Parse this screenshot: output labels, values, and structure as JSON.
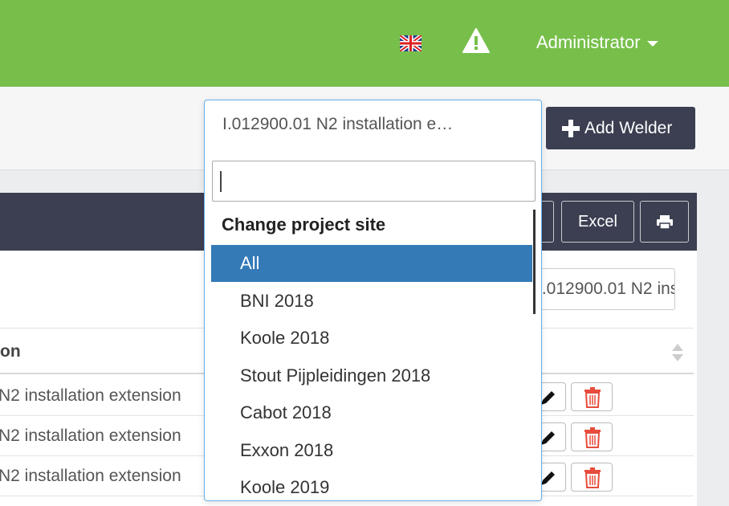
{
  "header": {
    "admin_label": "Administrator",
    "flag_icon": "uk-flag-icon",
    "warning_icon": "warning-icon"
  },
  "toolbar": {
    "add_welder_label": "Add Welder"
  },
  "panel": {
    "excel_label": "Excel",
    "filter_value": "I.012900.01 N2 installation e",
    "column_header": "on",
    "rows": [
      {
        "text": "N2 installation extension"
      },
      {
        "text": "N2 installation extension"
      },
      {
        "text": "N2 installation extension"
      }
    ]
  },
  "project_select": {
    "current_value": "I.012900.01 N2 installation e…",
    "search_value": "",
    "group_label": "Change project site",
    "options": [
      "All",
      "BNI 2018",
      "Koole 2018",
      "Stout Pijpleidingen 2018",
      "Cabot 2018",
      "Exxon 2018",
      "Koole 2019"
    ],
    "selected": "All"
  },
  "colors": {
    "top_bar": "#77bf4a",
    "dark_header": "#3b3f51",
    "selected_option": "#337ab7",
    "delete_red": "#e74c3c"
  }
}
